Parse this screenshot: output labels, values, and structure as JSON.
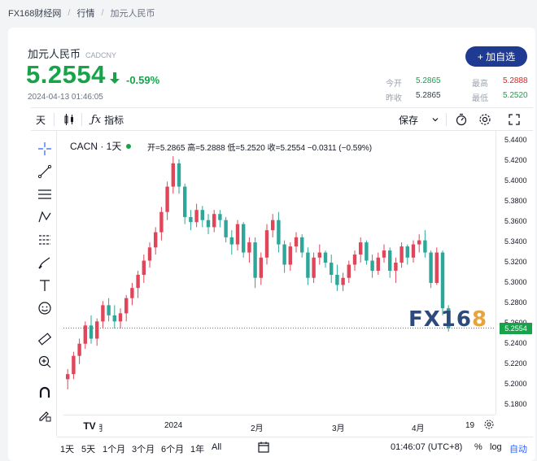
{
  "breadcrumb": {
    "site": "FX168财经网",
    "section": "行情",
    "page": "加元人民币"
  },
  "header": {
    "name": "加元人民币",
    "code": "CADCNY",
    "price": "5.2554",
    "change": "-0.59%",
    "time": "2024-04-13 01:46:05",
    "add_button": "+ 加自选",
    "stats": {
      "open_label": "今开",
      "open": "5.2865",
      "high_label": "最高",
      "high": "5.2888",
      "prev_label": "昨收",
      "prev": "5.2865",
      "low_label": "最低",
      "low": "5.2520"
    }
  },
  "toolbar": {
    "interval": "天",
    "indicators": "指标",
    "save": "保存"
  },
  "legend": {
    "symbol": "CACN · 1天",
    "ohlc_text": "开=5.2865 高=5.2888 低=5.2520 收=5.2554 −0.0311 (−0.59%)"
  },
  "axis": {
    "y_ticks": [
      "5.4400",
      "5.4200",
      "5.4000",
      "5.3800",
      "5.3600",
      "5.3400",
      "5.3200",
      "5.3000",
      "5.2800",
      "5.2600",
      "5.2400",
      "5.2200",
      "5.2000",
      "5.1800"
    ],
    "last_price": "5.2554",
    "x_ticks": [
      "12月",
      "2024",
      "2月",
      "3月",
      "4月",
      "19"
    ]
  },
  "bottombar": {
    "ranges": [
      "1天",
      "5天",
      "1个月",
      "3个月",
      "6个月",
      "1年",
      "All"
    ],
    "clock": "01:46:07 (UTC+8)",
    "pct": "%",
    "log": "log",
    "auto": "自动"
  },
  "watermark": {
    "text": "FX16",
    "eight": "8"
  },
  "colors": {
    "up": "#e0455a",
    "down": "#2ea69a",
    "accent": "#1f3a93",
    "green": "#16a34a"
  },
  "chart_data": {
    "type": "candlestick",
    "ylim": [
      5.17,
      5.45
    ],
    "candles": [
      [
        5.205,
        5.215,
        5.195,
        5.21
      ],
      [
        5.21,
        5.232,
        5.205,
        5.228
      ],
      [
        5.228,
        5.245,
        5.22,
        5.24
      ],
      [
        5.24,
        5.262,
        5.235,
        5.258
      ],
      [
        5.258,
        5.268,
        5.24,
        5.245
      ],
      [
        5.245,
        5.265,
        5.238,
        5.262
      ],
      [
        5.262,
        5.282,
        5.255,
        5.278
      ],
      [
        5.278,
        5.285,
        5.262,
        5.268
      ],
      [
        5.268,
        5.278,
        5.255,
        5.262
      ],
      [
        5.262,
        5.275,
        5.255,
        5.27
      ],
      [
        5.27,
        5.288,
        5.262,
        5.285
      ],
      [
        5.285,
        5.3,
        5.278,
        5.295
      ],
      [
        5.295,
        5.312,
        5.285,
        5.308
      ],
      [
        5.308,
        5.328,
        5.3,
        5.322
      ],
      [
        5.322,
        5.34,
        5.315,
        5.335
      ],
      [
        5.335,
        5.355,
        5.328,
        5.35
      ],
      [
        5.35,
        5.375,
        5.342,
        5.37
      ],
      [
        5.37,
        5.4,
        5.362,
        5.395
      ],
      [
        5.395,
        5.425,
        5.388,
        5.418
      ],
      [
        5.418,
        5.422,
        5.388,
        5.395
      ],
      [
        5.395,
        5.398,
        5.358,
        5.365
      ],
      [
        5.365,
        5.372,
        5.352,
        5.36
      ],
      [
        5.36,
        5.378,
        5.355,
        5.372
      ],
      [
        5.372,
        5.376,
        5.355,
        5.362
      ],
      [
        5.362,
        5.368,
        5.348,
        5.355
      ],
      [
        5.355,
        5.372,
        5.35,
        5.368
      ],
      [
        5.368,
        5.372,
        5.355,
        5.362
      ],
      [
        5.362,
        5.365,
        5.34,
        5.345
      ],
      [
        5.345,
        5.352,
        5.328,
        5.338
      ],
      [
        5.338,
        5.362,
        5.332,
        5.358
      ],
      [
        5.358,
        5.36,
        5.325,
        5.33
      ],
      [
        5.33,
        5.345,
        5.32,
        5.34
      ],
      [
        5.34,
        5.345,
        5.295,
        5.305
      ],
      [
        5.305,
        5.33,
        5.298,
        5.325
      ],
      [
        5.325,
        5.358,
        5.318,
        5.352
      ],
      [
        5.352,
        5.368,
        5.345,
        5.362
      ],
      [
        5.362,
        5.37,
        5.33,
        5.338
      ],
      [
        5.338,
        5.342,
        5.31,
        5.318
      ],
      [
        5.318,
        5.34,
        5.312,
        5.336
      ],
      [
        5.336,
        5.35,
        5.33,
        5.345
      ],
      [
        5.345,
        5.348,
        5.325,
        5.33
      ],
      [
        5.33,
        5.335,
        5.298,
        5.305
      ],
      [
        5.305,
        5.33,
        5.3,
        5.325
      ],
      [
        5.325,
        5.338,
        5.318,
        5.33
      ],
      [
        5.33,
        5.332,
        5.315,
        5.32
      ],
      [
        5.32,
        5.328,
        5.3,
        5.308
      ],
      [
        5.308,
        5.318,
        5.292,
        5.298
      ],
      [
        5.298,
        5.31,
        5.292,
        5.305
      ],
      [
        5.305,
        5.322,
        5.3,
        5.318
      ],
      [
        5.318,
        5.332,
        5.312,
        5.328
      ],
      [
        5.328,
        5.345,
        5.32,
        5.34
      ],
      [
        5.34,
        5.342,
        5.318,
        5.322
      ],
      [
        5.322,
        5.328,
        5.305,
        5.312
      ],
      [
        5.312,
        5.33,
        5.308,
        5.325
      ],
      [
        5.325,
        5.338,
        5.32,
        5.332
      ],
      [
        5.332,
        5.335,
        5.305,
        5.312
      ],
      [
        5.312,
        5.325,
        5.3,
        5.32
      ],
      [
        5.32,
        5.34,
        5.315,
        5.336
      ],
      [
        5.336,
        5.338,
        5.318,
        5.325
      ],
      [
        5.325,
        5.342,
        5.32,
        5.338
      ],
      [
        5.338,
        5.348,
        5.33,
        5.342
      ],
      [
        5.342,
        5.352,
        5.325,
        5.33
      ],
      [
        5.33,
        5.332,
        5.295,
        5.3
      ],
      [
        5.3,
        5.335,
        5.298,
        5.33
      ],
      [
        5.33,
        5.332,
        5.268,
        5.275
      ],
      [
        5.275,
        5.278,
        5.252,
        5.2554
      ]
    ]
  }
}
